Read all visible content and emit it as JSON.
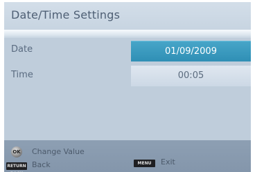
{
  "title": "Date/Time Settings",
  "rows": [
    {
      "label": "Date",
      "value": "01/09/2009"
    },
    {
      "label": "Time",
      "value": "00:05"
    }
  ],
  "footer": {
    "ok_key": "OK",
    "change_value": "Change Value",
    "return_key": "RETURN BACK",
    "back": "Back",
    "menu_key": "MENU",
    "exit": "Exit"
  },
  "colors": {
    "panel": "#bfcddb",
    "selected_row": "#3a9bc0",
    "footer": "#8a9cb0"
  }
}
